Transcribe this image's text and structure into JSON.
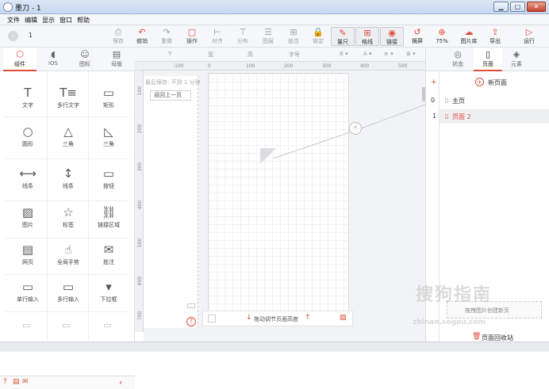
{
  "window": {
    "title": "墨刀 - 1",
    "min": "▁",
    "max": "▢",
    "close": "✕"
  },
  "menu": [
    "文件",
    "编辑",
    "显示",
    "窗口",
    "帮助"
  ],
  "toolbar": {
    "page_num": "1",
    "items": [
      {
        "icon": "⎙",
        "label": "保存"
      },
      {
        "icon": "↶",
        "label": "撤销"
      },
      {
        "icon": "↷",
        "label": "重做"
      },
      {
        "icon": "▢",
        "label": "操作"
      },
      {
        "icon": "⊢",
        "label": "对齐"
      },
      {
        "icon": "⊤",
        "label": "分布"
      },
      {
        "icon": "☰",
        "label": "图层"
      },
      {
        "icon": "⊞",
        "label": "组合"
      },
      {
        "icon": "🔒",
        "label": "锁定"
      },
      {
        "icon": "✎",
        "label": "量尺"
      },
      {
        "icon": "⊞",
        "label": "格线"
      },
      {
        "icon": "◉",
        "label": "链接"
      },
      {
        "icon": "↺",
        "label": "横屏"
      },
      {
        "icon": "⊕",
        "label": "75%"
      },
      {
        "icon": "☁",
        "label": "图片库"
      },
      {
        "icon": "⇪",
        "label": "导出"
      },
      {
        "icon": "▷",
        "label": "运行"
      }
    ]
  },
  "left_tabs": [
    {
      "icon": "⬡",
      "label": "组件"
    },
    {
      "icon": "",
      "label": "iOS"
    },
    {
      "icon": "☺",
      "label": "图标"
    },
    {
      "icon": "▤",
      "label": "母版"
    }
  ],
  "widgets": [
    {
      "icon": "T",
      "label": "文字"
    },
    {
      "icon": "T≡",
      "label": "多行文字"
    },
    {
      "icon": "▭",
      "label": "矩形"
    },
    {
      "icon": "○",
      "label": "圆形"
    },
    {
      "icon": "△",
      "label": "三角"
    },
    {
      "icon": "◺",
      "label": "三角"
    },
    {
      "icon": "⟷",
      "label": "线条"
    },
    {
      "icon": "↕",
      "label": "线条"
    },
    {
      "icon": "▭",
      "label": "按钮"
    },
    {
      "icon": "▨",
      "label": "图片"
    },
    {
      "icon": "☆",
      "label": "标签"
    },
    {
      "icon": "⛓",
      "label": "链接区域"
    },
    {
      "icon": "▤",
      "label": "网页"
    },
    {
      "icon": "☝",
      "label": "全局手势"
    },
    {
      "icon": "✉",
      "label": "批注"
    },
    {
      "icon": "▭",
      "label": "单行输入"
    },
    {
      "icon": "▭",
      "label": "多行输入"
    },
    {
      "icon": "▾",
      "label": "下拉框"
    }
  ],
  "props": {
    "y": "Y",
    "width": "宽",
    "height": "高",
    "fontsize": "字号"
  },
  "ruler_h": [
    "-100",
    "0",
    "100",
    "200",
    "300",
    "400",
    "500"
  ],
  "ruler_v": [
    "100",
    "200",
    "300",
    "400",
    "500",
    "600",
    "700"
  ],
  "canvas": {
    "save_status": "最后保存: 不到 1 分钟",
    "back_button": "返回上一页",
    "adjust_hint": "拖动调节页面高度",
    "help_icon": "?"
  },
  "right_tabs": [
    {
      "icon": "◎",
      "label": "状态"
    },
    {
      "icon": "▯",
      "label": "页面"
    },
    {
      "icon": "◈",
      "label": "元素"
    }
  ],
  "pages": {
    "new_page": "新页面",
    "list": [
      {
        "index": "0",
        "name": "主页",
        "active": false
      },
      {
        "index": "1",
        "name": "页面 2",
        "active": true
      }
    ],
    "create_from_image": "拖拽图片创建新页",
    "recycle": "页面回收站"
  },
  "watermark": "搜狗指南",
  "watermark_url": "zhinan.sogou.com",
  "colors": {
    "accent": "#e04d3a"
  }
}
